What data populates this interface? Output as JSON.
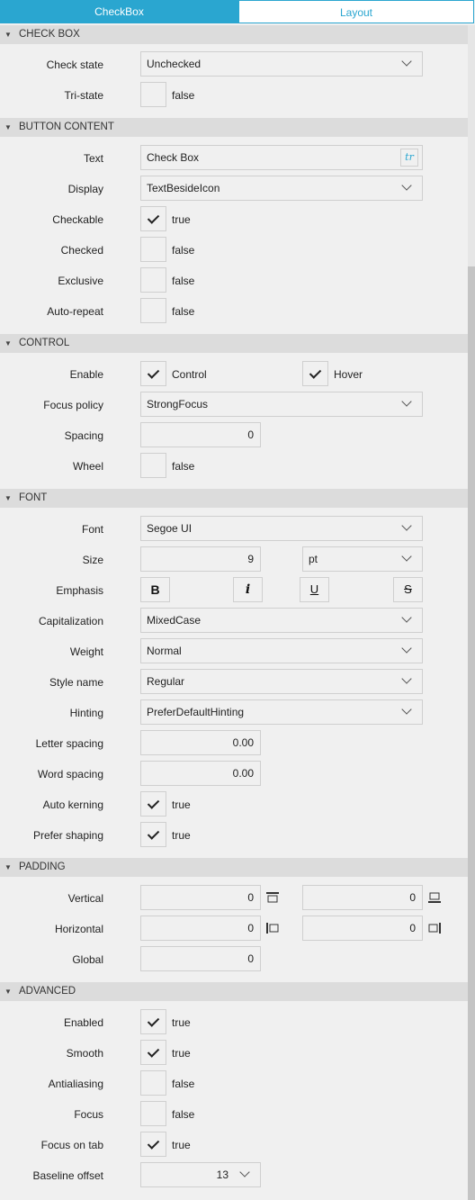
{
  "tabs": {
    "checkbox": "CheckBox",
    "layout": "Layout"
  },
  "sections": {
    "checkbox": "CHECK BOX",
    "button_content": "BUTTON CONTENT",
    "control": "CONTROL",
    "font": "FONT",
    "padding": "PADDING",
    "advanced": "ADVANCED"
  },
  "checkbox": {
    "check_state_label": "Check state",
    "check_state_value": "Unchecked",
    "tristate_label": "Tri-state",
    "tristate_value": "false"
  },
  "button_content": {
    "text_label": "Text",
    "text_value": "Check Box",
    "tr_button": "tr",
    "display_label": "Display",
    "display_value": "TextBesideIcon",
    "checkable_label": "Checkable",
    "checkable_value": "true",
    "checked_label": "Checked",
    "checked_value": "false",
    "exclusive_label": "Exclusive",
    "exclusive_value": "false",
    "autorepeat_label": "Auto-repeat",
    "autorepeat_value": "false"
  },
  "control": {
    "enable_label": "Enable",
    "control_text": "Control",
    "hover_text": "Hover",
    "focus_policy_label": "Focus policy",
    "focus_policy_value": "StrongFocus",
    "spacing_label": "Spacing",
    "spacing_value": "0",
    "wheel_label": "Wheel",
    "wheel_value": "false"
  },
  "font": {
    "font_label": "Font",
    "font_value": "Segoe UI",
    "size_label": "Size",
    "size_value": "9",
    "size_unit": "pt",
    "emphasis_label": "Emphasis",
    "bold": "B",
    "italic": "i",
    "underline": "U",
    "strike": "S",
    "cap_label": "Capitalization",
    "cap_value": "MixedCase",
    "weight_label": "Weight",
    "weight_value": "Normal",
    "style_label": "Style name",
    "style_value": "Regular",
    "hinting_label": "Hinting",
    "hinting_value": "PreferDefaultHinting",
    "letter_label": "Letter spacing",
    "letter_value": "0.00",
    "word_label": "Word spacing",
    "word_value": "0.00",
    "kerning_label": "Auto kerning",
    "kerning_value": "true",
    "shaping_label": "Prefer shaping",
    "shaping_value": "true"
  },
  "padding": {
    "vertical_label": "Vertical",
    "top_value": "0",
    "bottom_value": "0",
    "horizontal_label": "Horizontal",
    "left_value": "0",
    "right_value": "0",
    "global_label": "Global",
    "global_value": "0"
  },
  "advanced": {
    "enabled_label": "Enabled",
    "enabled_value": "true",
    "smooth_label": "Smooth",
    "smooth_value": "true",
    "antialias_label": "Antialiasing",
    "antialias_value": "false",
    "focus_label": "Focus",
    "focus_value": "false",
    "focustab_label": "Focus on tab",
    "focustab_value": "true",
    "baseline_label": "Baseline offset",
    "baseline_value": "13"
  },
  "colors": {
    "accent": "#2aa6d0",
    "section_bg": "#dcdcdc",
    "panel_bg": "#f0f0f0"
  }
}
